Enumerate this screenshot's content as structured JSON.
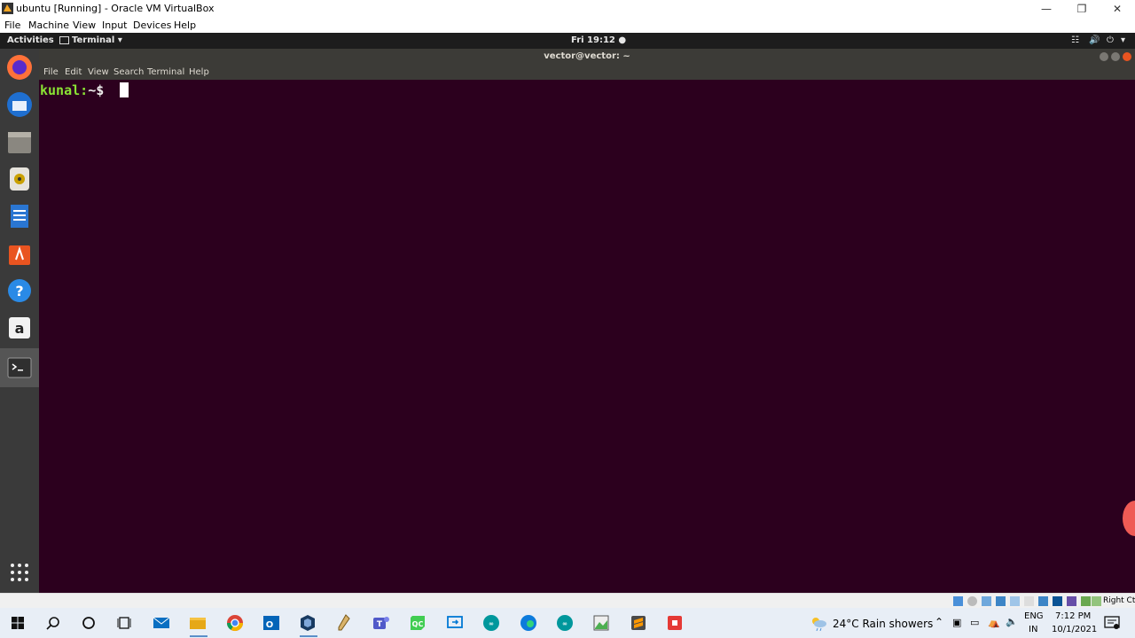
{
  "window": {
    "title": "ubuntu [Running] - Oracle VM VirtualBox"
  },
  "vbox_menu": [
    "File",
    "Machine",
    "View",
    "Input",
    "Devices",
    "Help"
  ],
  "gnome": {
    "activities": "Activities",
    "app_menu": "Terminal",
    "clock": "Fri 19:12"
  },
  "terminal": {
    "title": "vector@vector: ~",
    "menu": [
      "File",
      "Edit",
      "View",
      "Search",
      "Terminal",
      "Help"
    ],
    "prompt_user": "kunal:",
    "prompt_path": "~$"
  },
  "dock_items": [
    "firefox-icon",
    "thunderbird-icon",
    "files-icon",
    "rhythmbox-icon",
    "writer-icon",
    "software-icon",
    "help-icon",
    "amazon-icon",
    "terminal-icon",
    "show-apps-icon"
  ],
  "vbox_status": {
    "host_key": "Right Ctrl"
  },
  "taskbar": {
    "weather_temp": "24°C",
    "weather_desc": "Rain showers",
    "lang_top": "ENG",
    "lang_bottom": "IN",
    "time": "7:12 PM",
    "date": "10/1/2021"
  },
  "colors": {
    "terminal_bg": "#2c001e",
    "prompt_green": "#8ae234",
    "dock_bg": "#3a3a3a"
  }
}
